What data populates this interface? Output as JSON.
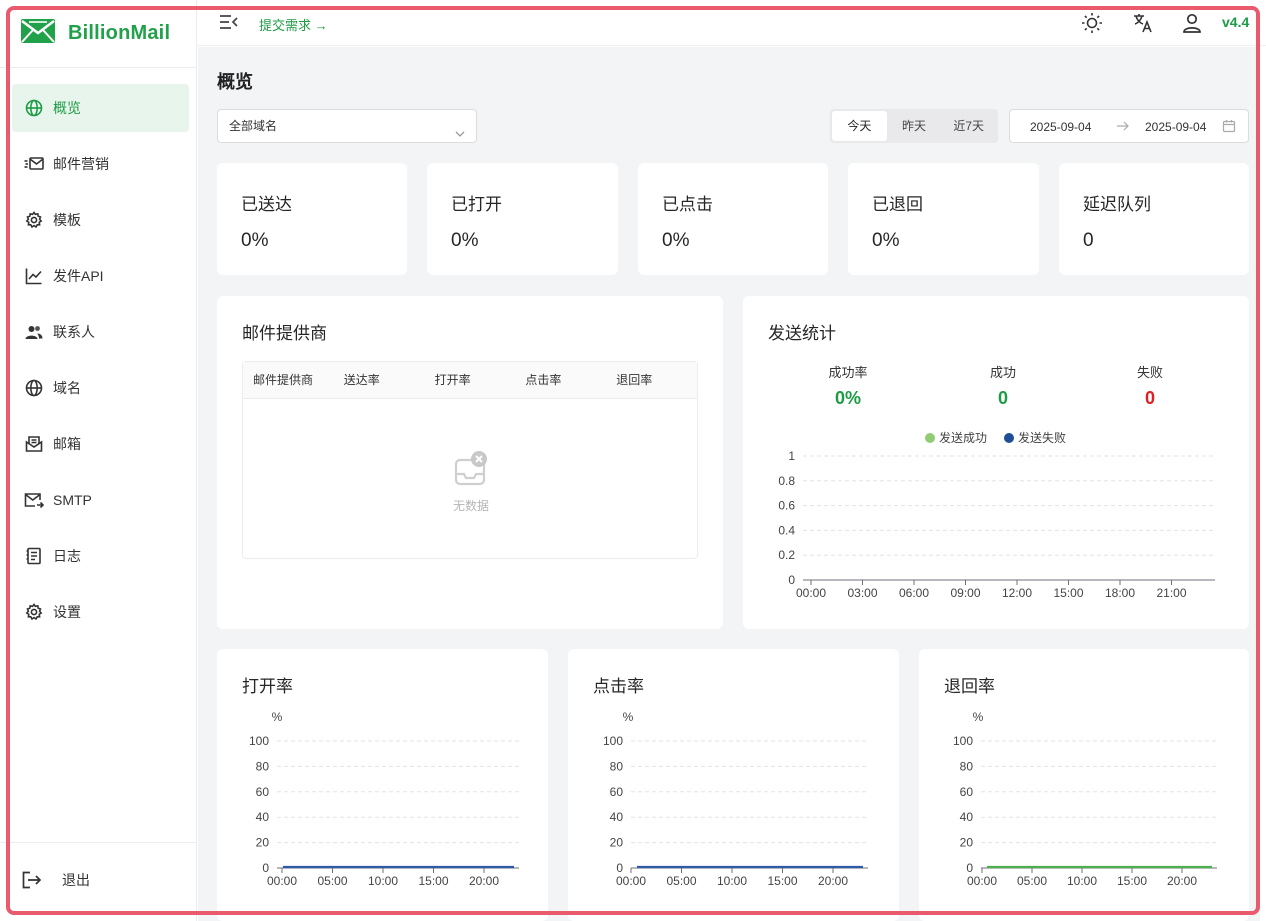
{
  "app": {
    "name": "BillionMail",
    "version": "v4.4",
    "brand_color": "#21a14a"
  },
  "topbar": {
    "submit_link": "提交需求 →"
  },
  "sidebar": {
    "items": [
      {
        "label": "概览",
        "icon": "globe-icon",
        "active": true
      },
      {
        "label": "邮件营销",
        "icon": "mail-send-icon",
        "active": false
      },
      {
        "label": "模板",
        "icon": "gear-icon",
        "active": false
      },
      {
        "label": "发件API",
        "icon": "line-chart-icon",
        "active": false
      },
      {
        "label": "联系人",
        "icon": "contacts-icon",
        "active": false
      },
      {
        "label": "域名",
        "icon": "globe-icon",
        "active": false
      },
      {
        "label": "邮箱",
        "icon": "mailbox-icon",
        "active": false
      },
      {
        "label": "SMTP",
        "icon": "smtp-mail-icon",
        "active": false
      },
      {
        "label": "日志",
        "icon": "log-icon",
        "active": false
      },
      {
        "label": "设置",
        "icon": "gear-icon",
        "active": false
      }
    ],
    "logout": "退出"
  },
  "page": {
    "title": "概览",
    "domain_select": "全部域名",
    "range_buttons": [
      "今天",
      "昨天",
      "近7天"
    ],
    "date_from": "2025-09-04",
    "date_to": "2025-09-04"
  },
  "stats": [
    {
      "label": "已送达",
      "value": "0%"
    },
    {
      "label": "已打开",
      "value": "0%"
    },
    {
      "label": "已点击",
      "value": "0%"
    },
    {
      "label": "已退回",
      "value": "0%"
    },
    {
      "label": "延迟队列",
      "value": "0"
    }
  ],
  "providers": {
    "title": "邮件提供商",
    "columns": [
      "邮件提供商",
      "送达率",
      "打开率",
      "点击率",
      "退回率"
    ],
    "empty_text": "无数据"
  },
  "send_stats": {
    "title": "发送统计",
    "metrics": [
      {
        "label": "成功率",
        "value": "0%",
        "color": "#1e9b45"
      },
      {
        "label": "成功",
        "value": "0",
        "color": "#1e9b45"
      },
      {
        "label": "失败",
        "value": "0",
        "color": "#e02020"
      }
    ]
  },
  "chart_data": [
    {
      "id": "send-stats",
      "type": "line",
      "title": "",
      "x": [
        "00:00",
        "03:00",
        "06:00",
        "09:00",
        "12:00",
        "15:00",
        "18:00",
        "21:00"
      ],
      "ylim": [
        0,
        1
      ],
      "yticks": [
        "0",
        "0.2",
        "0.4",
        "0.6",
        "0.8",
        "1"
      ],
      "legend_position": "top-center",
      "grid": true,
      "series": [
        {
          "name": "发送成功",
          "color": "#91cc75",
          "values": []
        },
        {
          "name": "发送失败",
          "color": "#1f4e96",
          "values": []
        }
      ]
    },
    {
      "id": "open-rate",
      "type": "line",
      "title": "打开率",
      "ylabel": "%",
      "x": [
        "00:00",
        "05:00",
        "10:00",
        "15:00",
        "20:00"
      ],
      "ylim": [
        0,
        100
      ],
      "yticks": [
        "0",
        "20",
        "40",
        "60",
        "80",
        "100"
      ],
      "grid": true,
      "series": [
        {
          "color": "#2f5aa8",
          "values": [
            0,
            0,
            0,
            0,
            0
          ]
        }
      ]
    },
    {
      "id": "click-rate",
      "type": "line",
      "title": "点击率",
      "ylabel": "%",
      "x": [
        "00:00",
        "05:00",
        "10:00",
        "15:00",
        "20:00"
      ],
      "ylim": [
        0,
        100
      ],
      "yticks": [
        "0",
        "20",
        "40",
        "60",
        "80",
        "100"
      ],
      "grid": true,
      "series": [
        {
          "color": "#2f5aa8",
          "values": [
            0,
            0,
            0,
            0,
            0
          ]
        }
      ]
    },
    {
      "id": "bounce-rate",
      "type": "line",
      "title": "退回率",
      "ylabel": "%",
      "x": [
        "00:00",
        "05:00",
        "10:00",
        "15:00",
        "20:00"
      ],
      "ylim": [
        0,
        100
      ],
      "yticks": [
        "0",
        "20",
        "40",
        "60",
        "80",
        "100"
      ],
      "grid": true,
      "series": [
        {
          "color": "#4caf50",
          "values": [
            0,
            0,
            0,
            0,
            0
          ]
        }
      ]
    }
  ]
}
